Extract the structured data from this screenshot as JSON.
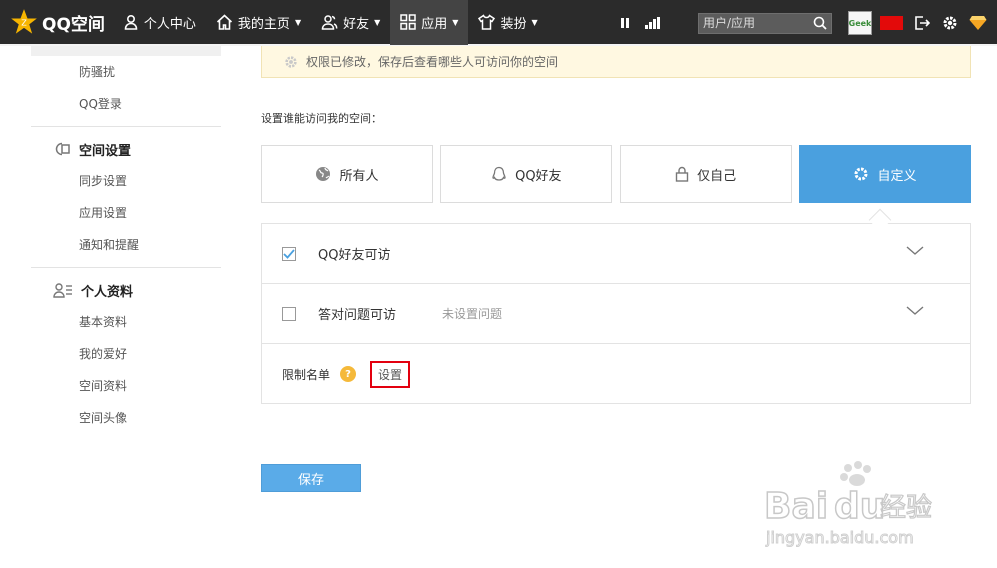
{
  "topbar": {
    "logo_text": "QQ空间",
    "nav": [
      {
        "label": "个人中心"
      },
      {
        "label": "我的主页"
      },
      {
        "label": "好友"
      },
      {
        "label": "应用"
      },
      {
        "label": "装扮"
      }
    ],
    "search": {
      "placeholder": "用户/应用"
    },
    "avatar_text": "Geek"
  },
  "sidebar": {
    "items_top": [
      "防骚扰",
      "QQ登录"
    ],
    "groups": [
      {
        "title": "空间设置",
        "items": [
          "同步设置",
          "应用设置",
          "通知和提醒"
        ]
      },
      {
        "title": "个人资料",
        "items": [
          "基本资料",
          "我的爱好",
          "空间资料",
          "空间头像"
        ]
      }
    ]
  },
  "notice": {
    "text": "权限已修改，保存后查看哪些人可访问你的空间"
  },
  "access": {
    "label": "设置谁能访问我的空间：",
    "options": [
      {
        "label": "所有人",
        "selected": false
      },
      {
        "label": "QQ好友",
        "selected": false
      },
      {
        "label": "仅自己",
        "selected": false
      },
      {
        "label": "自定义",
        "selected": true
      }
    ]
  },
  "panel": {
    "rows": [
      {
        "label": "QQ好友可访",
        "checked": true,
        "sub": ""
      },
      {
        "label": "答对问题可访",
        "checked": false,
        "sub": "未设置问题"
      }
    ],
    "limit_label": "限制名单",
    "set_button": "设置"
  },
  "save_label": "保存",
  "colors": {
    "accent": "#4aa0df",
    "topbar": "#2b2b2b",
    "highlight": "#e3000f"
  }
}
